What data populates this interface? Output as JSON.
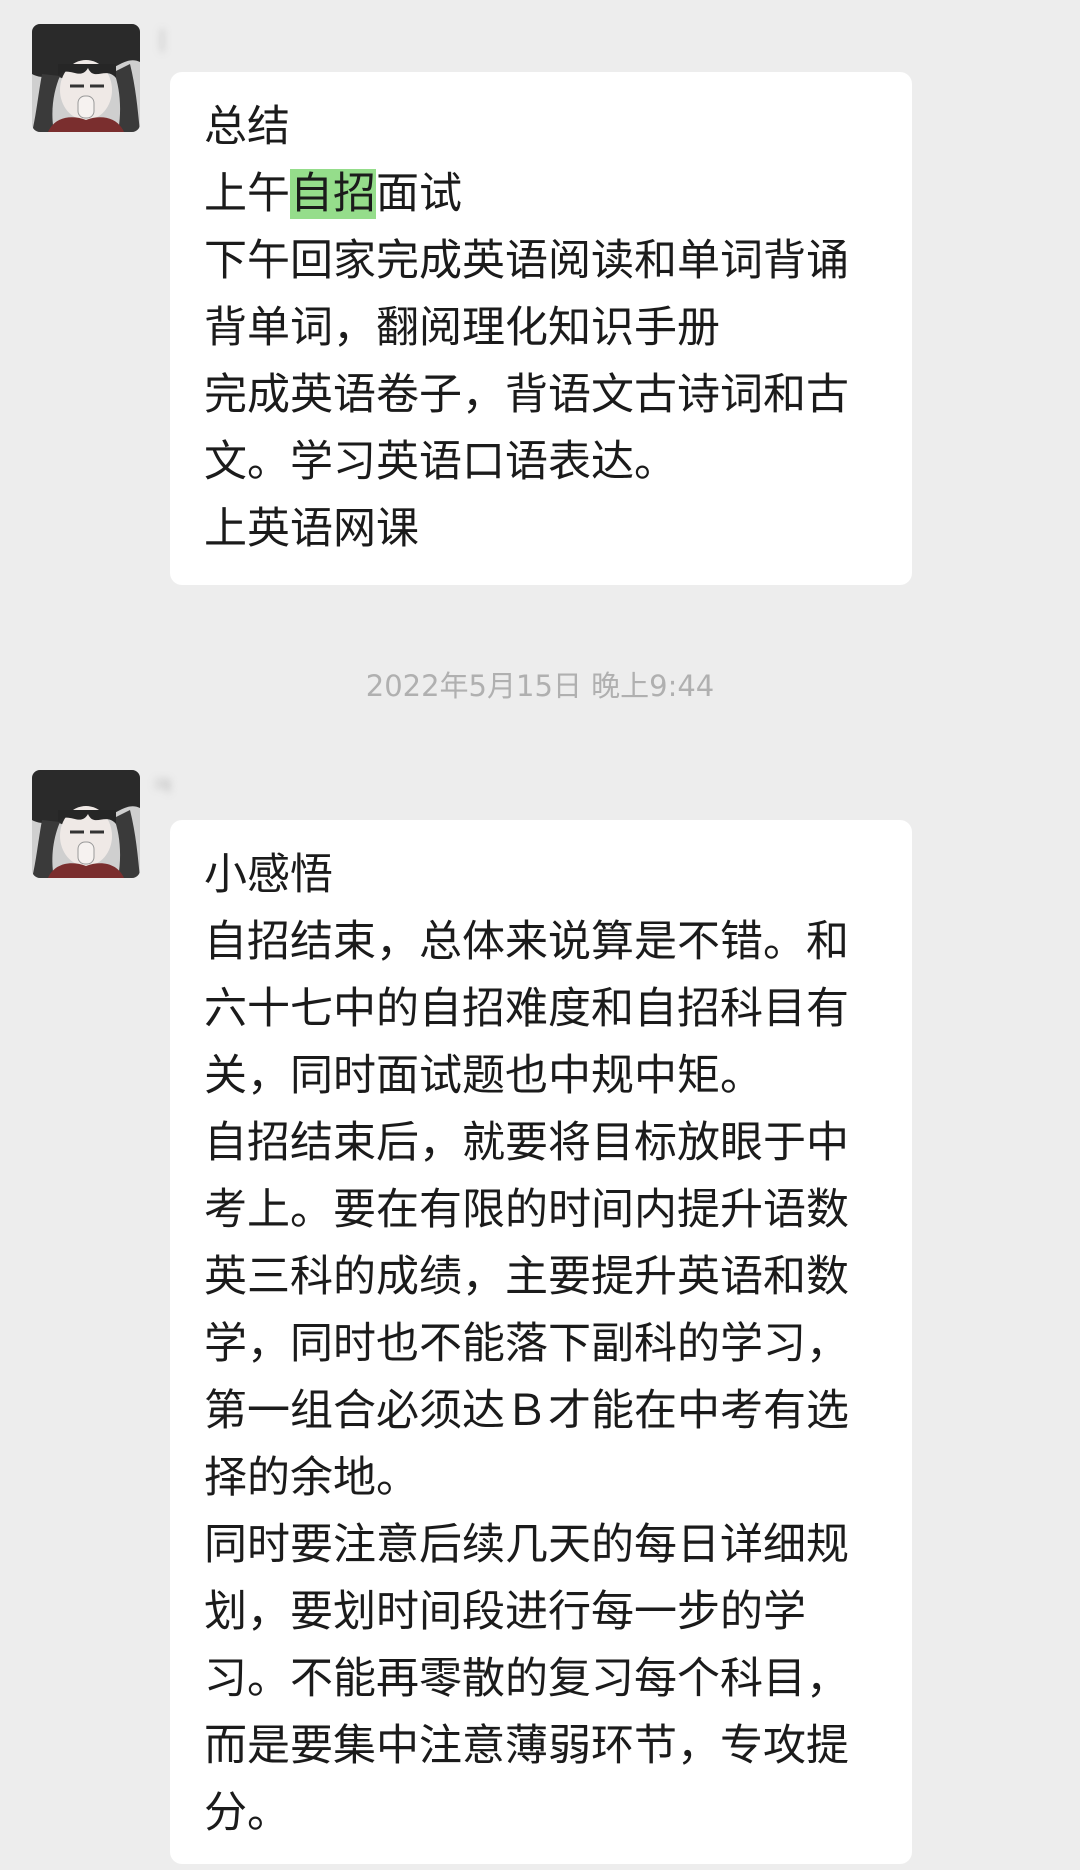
{
  "colors": {
    "background": "#ededed",
    "bubble": "#ffffff",
    "highlight": "#95dd8b",
    "timestamp_text": "#b0b0b0"
  },
  "messages": [
    {
      "sender": "ㅣ",
      "avatar_icon": "anime-avatar-icon",
      "lines": [
        {
          "text": "总结"
        },
        {
          "before": "上午",
          "highlight": "自招",
          "after": "面试"
        },
        {
          "text": "下午回家完成英语阅读和单词背诵"
        },
        {
          "text": "背单词，翻阅理化知识手册"
        },
        {
          "text": "完成英语卷子，背语文古诗词和古"
        },
        {
          "text": "文。学习英语口语表达。"
        },
        {
          "text": "上英语网课"
        }
      ]
    },
    {
      "sender": "ㅋ",
      "avatar_icon": "anime-avatar-icon",
      "lines": [
        {
          "text": "小感悟"
        },
        {
          "text": "自招结束，总体来说算是不错。和"
        },
        {
          "text": "六十七中的自招难度和自招科目有"
        },
        {
          "text": "关，同时面试题也中规中矩。"
        },
        {
          "text": "自招结束后，就要将目标放眼于中"
        },
        {
          "text": "考上。要在有限的时间内提升语数"
        },
        {
          "text": "英三科的成绩，主要提升英语和数"
        },
        {
          "text": "学，同时也不能落下副科的学习，"
        },
        {
          "text": "第一组合必须达Ｂ才能在中考有选"
        },
        {
          "text": "择的余地。"
        },
        {
          "text": "同时要注意后续几天的每日详细规"
        },
        {
          "text": "划，要划时间段进行每一步的学"
        },
        {
          "text": "习。不能再零散的复习每个科目，"
        },
        {
          "text": "而是要集中注意薄弱环节，专攻提"
        },
        {
          "text": "分。"
        }
      ]
    }
  ],
  "timestamp": "2022年5月15日 晚上9:44"
}
